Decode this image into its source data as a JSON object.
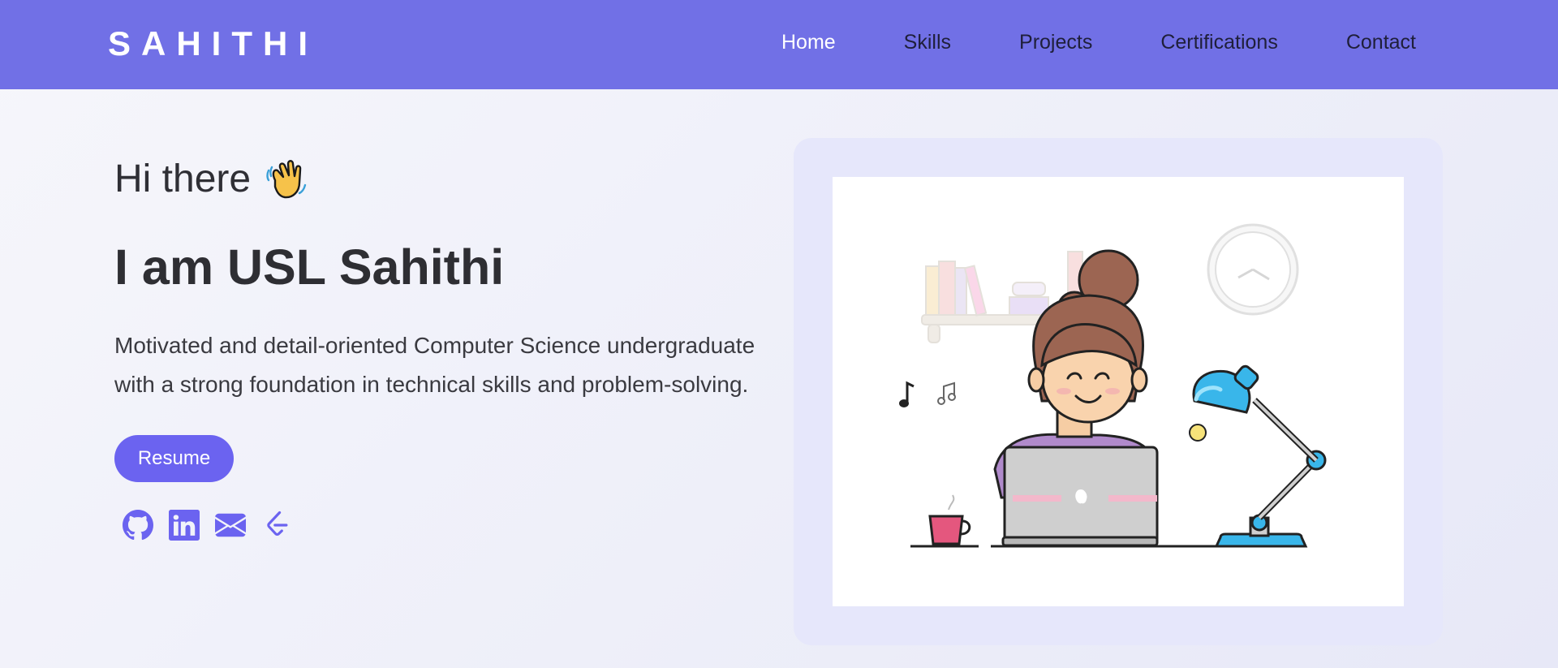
{
  "navbar": {
    "brand": "SAHITHI",
    "links": [
      {
        "label": "Home",
        "active": true
      },
      {
        "label": "Skills",
        "active": false
      },
      {
        "label": "Projects",
        "active": false
      },
      {
        "label": "Certifications",
        "active": false
      },
      {
        "label": "Contact",
        "active": false
      }
    ]
  },
  "hero": {
    "greeting": "Hi there",
    "greeting_icon": "waving-hand-icon",
    "headline": "I am USL Sahithi",
    "bio": "Motivated and detail-oriented Computer Science undergraduate with a strong foundation in technical skills and problem-solving.",
    "resume_label": "Resume",
    "socials": [
      "github-icon",
      "linkedin-icon",
      "email-icon",
      "leetcode-icon"
    ]
  },
  "illustration": {
    "subject": "girl-working-on-laptop-illustration"
  },
  "colors": {
    "navbar": "#7170e6",
    "accent": "#6b63f0",
    "card": "#e6e7fb"
  }
}
